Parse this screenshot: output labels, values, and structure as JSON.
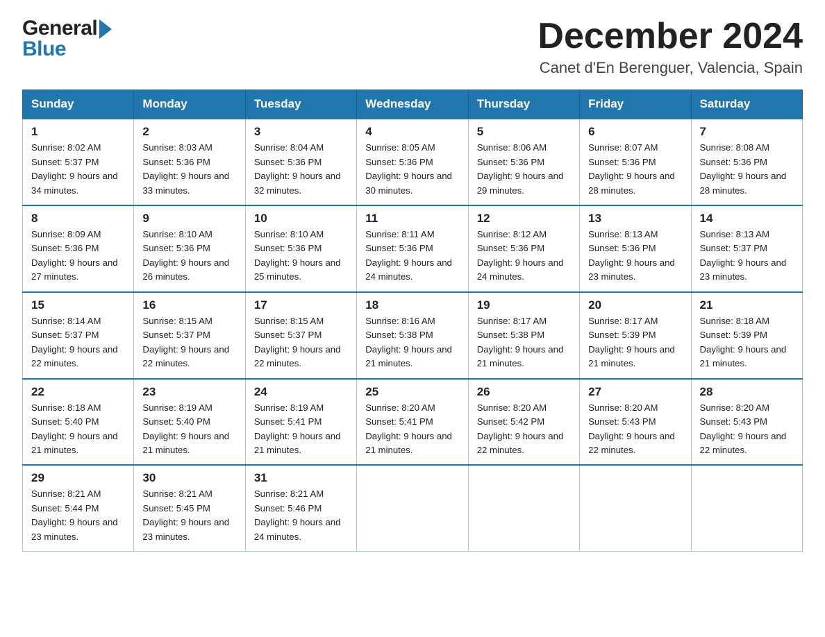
{
  "header": {
    "logo_general": "General",
    "logo_blue": "Blue",
    "month_title": "December 2024",
    "location": "Canet d'En Berenguer, Valencia, Spain"
  },
  "weekdays": [
    "Sunday",
    "Monday",
    "Tuesday",
    "Wednesday",
    "Thursday",
    "Friday",
    "Saturday"
  ],
  "weeks": [
    [
      {
        "day": "1",
        "sunrise": "8:02 AM",
        "sunset": "5:37 PM",
        "daylight": "9 hours and 34 minutes."
      },
      {
        "day": "2",
        "sunrise": "8:03 AM",
        "sunset": "5:36 PM",
        "daylight": "9 hours and 33 minutes."
      },
      {
        "day": "3",
        "sunrise": "8:04 AM",
        "sunset": "5:36 PM",
        "daylight": "9 hours and 32 minutes."
      },
      {
        "day": "4",
        "sunrise": "8:05 AM",
        "sunset": "5:36 PM",
        "daylight": "9 hours and 30 minutes."
      },
      {
        "day": "5",
        "sunrise": "8:06 AM",
        "sunset": "5:36 PM",
        "daylight": "9 hours and 29 minutes."
      },
      {
        "day": "6",
        "sunrise": "8:07 AM",
        "sunset": "5:36 PM",
        "daylight": "9 hours and 28 minutes."
      },
      {
        "day": "7",
        "sunrise": "8:08 AM",
        "sunset": "5:36 PM",
        "daylight": "9 hours and 28 minutes."
      }
    ],
    [
      {
        "day": "8",
        "sunrise": "8:09 AM",
        "sunset": "5:36 PM",
        "daylight": "9 hours and 27 minutes."
      },
      {
        "day": "9",
        "sunrise": "8:10 AM",
        "sunset": "5:36 PM",
        "daylight": "9 hours and 26 minutes."
      },
      {
        "day": "10",
        "sunrise": "8:10 AM",
        "sunset": "5:36 PM",
        "daylight": "9 hours and 25 minutes."
      },
      {
        "day": "11",
        "sunrise": "8:11 AM",
        "sunset": "5:36 PM",
        "daylight": "9 hours and 24 minutes."
      },
      {
        "day": "12",
        "sunrise": "8:12 AM",
        "sunset": "5:36 PM",
        "daylight": "9 hours and 24 minutes."
      },
      {
        "day": "13",
        "sunrise": "8:13 AM",
        "sunset": "5:36 PM",
        "daylight": "9 hours and 23 minutes."
      },
      {
        "day": "14",
        "sunrise": "8:13 AM",
        "sunset": "5:37 PM",
        "daylight": "9 hours and 23 minutes."
      }
    ],
    [
      {
        "day": "15",
        "sunrise": "8:14 AM",
        "sunset": "5:37 PM",
        "daylight": "9 hours and 22 minutes."
      },
      {
        "day": "16",
        "sunrise": "8:15 AM",
        "sunset": "5:37 PM",
        "daylight": "9 hours and 22 minutes."
      },
      {
        "day": "17",
        "sunrise": "8:15 AM",
        "sunset": "5:37 PM",
        "daylight": "9 hours and 22 minutes."
      },
      {
        "day": "18",
        "sunrise": "8:16 AM",
        "sunset": "5:38 PM",
        "daylight": "9 hours and 21 minutes."
      },
      {
        "day": "19",
        "sunrise": "8:17 AM",
        "sunset": "5:38 PM",
        "daylight": "9 hours and 21 minutes."
      },
      {
        "day": "20",
        "sunrise": "8:17 AM",
        "sunset": "5:39 PM",
        "daylight": "9 hours and 21 minutes."
      },
      {
        "day": "21",
        "sunrise": "8:18 AM",
        "sunset": "5:39 PM",
        "daylight": "9 hours and 21 minutes."
      }
    ],
    [
      {
        "day": "22",
        "sunrise": "8:18 AM",
        "sunset": "5:40 PM",
        "daylight": "9 hours and 21 minutes."
      },
      {
        "day": "23",
        "sunrise": "8:19 AM",
        "sunset": "5:40 PM",
        "daylight": "9 hours and 21 minutes."
      },
      {
        "day": "24",
        "sunrise": "8:19 AM",
        "sunset": "5:41 PM",
        "daylight": "9 hours and 21 minutes."
      },
      {
        "day": "25",
        "sunrise": "8:20 AM",
        "sunset": "5:41 PM",
        "daylight": "9 hours and 21 minutes."
      },
      {
        "day": "26",
        "sunrise": "8:20 AM",
        "sunset": "5:42 PM",
        "daylight": "9 hours and 22 minutes."
      },
      {
        "day": "27",
        "sunrise": "8:20 AM",
        "sunset": "5:43 PM",
        "daylight": "9 hours and 22 minutes."
      },
      {
        "day": "28",
        "sunrise": "8:20 AM",
        "sunset": "5:43 PM",
        "daylight": "9 hours and 22 minutes."
      }
    ],
    [
      {
        "day": "29",
        "sunrise": "8:21 AM",
        "sunset": "5:44 PM",
        "daylight": "9 hours and 23 minutes."
      },
      {
        "day": "30",
        "sunrise": "8:21 AM",
        "sunset": "5:45 PM",
        "daylight": "9 hours and 23 minutes."
      },
      {
        "day": "31",
        "sunrise": "8:21 AM",
        "sunset": "5:46 PM",
        "daylight": "9 hours and 24 minutes."
      },
      null,
      null,
      null,
      null
    ]
  ]
}
